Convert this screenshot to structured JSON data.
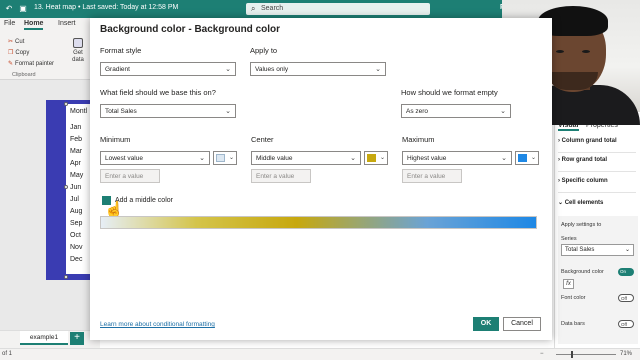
{
  "titlebar": {
    "title": "13. Heat map • Last saved: Today at 12:58 PM",
    "search_placeholder": "Search",
    "right_initial": "P"
  },
  "ribbon": {
    "tabs": [
      "File",
      "Home",
      "Insert"
    ],
    "items": [
      "Cut",
      "Copy",
      "Format painter"
    ],
    "group_label": "Clipboard",
    "get_data": [
      "Get",
      "data"
    ]
  },
  "canvas": {
    "matrix_header": "Montl",
    "months": [
      "Jan",
      "Feb",
      "Mar",
      "Apr",
      "May",
      "Jun",
      "Jul",
      "Aug",
      "Sep",
      "Oct",
      "Nov",
      "Dec"
    ]
  },
  "page_tab": "example1",
  "status": {
    "left": "of 1",
    "zoom": "71%"
  },
  "pane": {
    "tabs": [
      "Visual",
      "Properties"
    ],
    "rows": [
      "Column grand total",
      "Row grand total",
      "Specific column",
      "Cell elements"
    ],
    "apply_label": "Apply settings to",
    "series_label": "Series",
    "series_value": "Total Sales",
    "background_color": "Background color",
    "font_color": "Font color",
    "data_bars": "Data bars",
    "toggle_on": "On",
    "toggle_off": "Off"
  },
  "dialog": {
    "title": "Background color - Background color",
    "format_style_label": "Format style",
    "format_style_value": "Gradient",
    "apply_to_label": "Apply to",
    "apply_to_value": "Values only",
    "base_field_label": "What field should we base this on?",
    "base_field_value": "Total Sales",
    "empty_label": "How should we format empty",
    "empty_value": "As zero",
    "minimum_label": "Minimum",
    "minimum_value": "Lowest value",
    "center_label": "Center",
    "center_value": "Middle value",
    "maximum_label": "Maximum",
    "maximum_value": "Highest value",
    "value_placeholder": "Enter a value",
    "middle_color_label": "Add a middle color",
    "learn_more": "Learn more about conditional formatting",
    "ok": "OK",
    "cancel": "Cancel"
  },
  "colors": {
    "accent": "#1d7f74",
    "minimum_color": "#dde8f2",
    "center_color": "#c7a80f",
    "maximum_color": "#1e88e5"
  }
}
